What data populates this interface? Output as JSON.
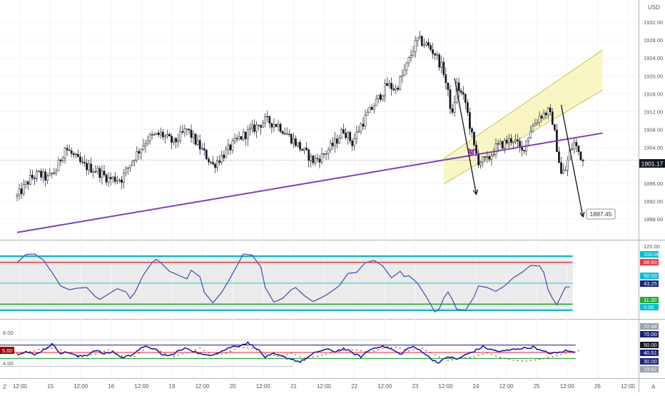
{
  "currency": "USD",
  "last_price": "1901.17",
  "target_label": "1887.45",
  "bottom_left_label": "Z",
  "bottom_right_label": "A",
  "colors": {
    "background": "#ffffff",
    "candle": "#131722",
    "trendline": "#7b3fbf",
    "channel_fill": "#f7f3b0",
    "channel_line": "#c9c25a",
    "osc_line": "#3f4fa8",
    "osc_band_fill": "#e3e3e3",
    "level_cyan": "#00bcd4",
    "level_red": "#f23645",
    "level_green": "#22ab36",
    "level_navy": "#1a1a8c",
    "rsi_dots": "#c62828",
    "rsi_badge_red": "#a00000"
  },
  "icons": [
    "alarm-clock-icon"
  ],
  "chart_data": [
    {
      "type": "candlestick",
      "name": "price",
      "ylim": [
        1884,
        1936
      ],
      "y_ticks": [
        1888,
        1892,
        1896,
        1900,
        1904,
        1908,
        1912,
        1916,
        1920,
        1924,
        1928,
        1932
      ],
      "y_tick_labels": [
        "1888.00",
        "1892.00",
        "1896.00",
        "1900.00",
        "1904.00",
        "1908.00",
        "1912.00",
        "1916.00",
        "1920.00",
        "1924.00",
        "1928.00",
        "1932.00"
      ],
      "x_tick_labels": [
        "12:00",
        "15",
        "12:00",
        "16",
        "12:00",
        "19",
        "12:00",
        "20",
        "12:00",
        "21",
        "12:00",
        "22",
        "12:00",
        "23",
        "12:00",
        "24",
        "12:00",
        "25",
        "12:00",
        "26",
        "12:00"
      ],
      "anchor_points": [
        [
          0,
          1893
        ],
        [
          6,
          1897
        ],
        [
          10,
          1898
        ],
        [
          14,
          1897
        ],
        [
          18,
          1899
        ],
        [
          22,
          1904
        ],
        [
          26,
          1902
        ],
        [
          30,
          1900
        ],
        [
          36,
          1899
        ],
        [
          42,
          1897
        ],
        [
          48,
          1897
        ],
        [
          54,
          1902
        ],
        [
          60,
          1906
        ],
        [
          66,
          1907
        ],
        [
          72,
          1905
        ],
        [
          78,
          1908
        ],
        [
          84,
          1904
        ],
        [
          90,
          1900
        ],
        [
          96,
          1903
        ],
        [
          102,
          1906
        ],
        [
          108,
          1908
        ],
        [
          114,
          1910
        ],
        [
          120,
          1909
        ],
        [
          126,
          1906
        ],
        [
          132,
          1903
        ],
        [
          136,
          1901
        ],
        [
          140,
          1902
        ],
        [
          146,
          1905
        ],
        [
          150,
          1908
        ],
        [
          154,
          1905
        ],
        [
          158,
          1909
        ],
        [
          162,
          1912
        ],
        [
          166,
          1915
        ],
        [
          170,
          1918
        ],
        [
          174,
          1917
        ],
        [
          178,
          1921
        ],
        [
          182,
          1926
        ],
        [
          184,
          1928
        ],
        [
          188,
          1927
        ],
        [
          192,
          1925
        ],
        [
          196,
          1921
        ],
        [
          198,
          1916
        ],
        [
          200,
          1911
        ],
        [
          202,
          1918
        ],
        [
          206,
          1914
        ],
        [
          210,
          1904
        ],
        [
          212,
          1901
        ],
        [
          216,
          1901
        ],
        [
          220,
          1904
        ],
        [
          224,
          1905
        ],
        [
          228,
          1906
        ],
        [
          232,
          1903
        ],
        [
          236,
          1908
        ],
        [
          240,
          1911
        ],
        [
          244,
          1912
        ],
        [
          246,
          1910
        ],
        [
          248,
          1904
        ],
        [
          250,
          1898
        ],
        [
          252,
          1899
        ],
        [
          254,
          1903
        ],
        [
          256,
          1905
        ],
        [
          258,
          1903
        ],
        [
          260,
          1901
        ]
      ],
      "annotations": {
        "trendline": [
          [
            0,
            1885
          ],
          [
            269,
            1907.2
          ]
        ],
        "channel_lower": [
          [
            196,
            1895.8
          ],
          [
            269,
            1916.8
          ]
        ],
        "channel_upper": [
          [
            196,
            1901.5
          ],
          [
            269,
            1925.8
          ]
        ],
        "arrow_left": [
          [
            201,
            1919.5
          ],
          [
            211,
            1893.5
          ]
        ],
        "arrow_right": [
          [
            250,
            1913.5
          ],
          [
            260,
            1888.5
          ]
        ]
      }
    },
    {
      "type": "line",
      "name": "oscillator",
      "ylim": [
        -12,
        125
      ],
      "levels": [
        {
          "value": 100.0,
          "label": "100.00",
          "color": "#00bcd4"
        },
        {
          "value": 88.6,
          "label": "88.60",
          "color": "#f23645"
        },
        {
          "value": 50.0,
          "label": "50.00",
          "color": "#00bcd4"
        },
        {
          "value": 11.3,
          "label": "11.30",
          "color": "#22ab36"
        },
        {
          "value": 0.0,
          "label": "0.00",
          "color": "#00bcd4"
        }
      ],
      "current_value": "43.25",
      "y_ticks": [
        120
      ],
      "y_tick_labels": [
        "120.00"
      ],
      "anchor_points": [
        [
          0,
          88
        ],
        [
          4,
          103
        ],
        [
          8,
          104
        ],
        [
          12,
          93
        ],
        [
          16,
          70
        ],
        [
          20,
          45
        ],
        [
          24,
          38
        ],
        [
          28,
          41
        ],
        [
          32,
          42
        ],
        [
          36,
          25
        ],
        [
          38,
          20
        ],
        [
          42,
          30
        ],
        [
          46,
          40
        ],
        [
          50,
          34
        ],
        [
          52,
          22
        ],
        [
          54,
          32
        ],
        [
          58,
          65
        ],
        [
          62,
          88
        ],
        [
          64,
          94
        ],
        [
          66,
          88
        ],
        [
          70,
          72
        ],
        [
          74,
          65
        ],
        [
          78,
          58
        ],
        [
          80,
          74
        ],
        [
          84,
          62
        ],
        [
          86,
          33
        ],
        [
          90,
          14
        ],
        [
          94,
          33
        ],
        [
          98,
          60
        ],
        [
          104,
          104
        ],
        [
          108,
          102
        ],
        [
          112,
          80
        ],
        [
          114,
          42
        ],
        [
          118,
          15
        ],
        [
          122,
          22
        ],
        [
          126,
          38
        ],
        [
          128,
          42
        ],
        [
          132,
          27
        ],
        [
          136,
          16
        ],
        [
          142,
          28
        ],
        [
          148,
          45
        ],
        [
          152,
          68
        ],
        [
          156,
          70
        ],
        [
          160,
          88
        ],
        [
          164,
          92
        ],
        [
          168,
          82
        ],
        [
          172,
          60
        ],
        [
          176,
          72
        ],
        [
          178,
          62
        ],
        [
          180,
          64
        ],
        [
          184,
          50
        ],
        [
          188,
          25
        ],
        [
          192,
          -3
        ],
        [
          194,
          3
        ],
        [
          196,
          22
        ],
        [
          198,
          34
        ],
        [
          200,
          20
        ],
        [
          202,
          2
        ],
        [
          206,
          0
        ],
        [
          210,
          25
        ],
        [
          212,
          45
        ],
        [
          216,
          42
        ],
        [
          220,
          35
        ],
        [
          224,
          45
        ],
        [
          228,
          60
        ],
        [
          232,
          70
        ],
        [
          236,
          83
        ],
        [
          240,
          82
        ],
        [
          242,
          70
        ],
        [
          244,
          38
        ],
        [
          246,
          22
        ],
        [
          248,
          10
        ],
        [
          252,
          43
        ],
        [
          254,
          43
        ]
      ]
    },
    {
      "type": "line",
      "name": "rsi-oscillator",
      "ylim": [
        0,
        12.5
      ],
      "levels": [
        {
          "value": 7.3,
          "label": "70.00",
          "color": "#1a1a8c"
        },
        {
          "value": 5.6,
          "label": "50.00",
          "color": "#f23645"
        },
        {
          "value": 4.2,
          "label": "30.00",
          "color": "#22ab36"
        }
      ],
      "current_value": "40.51",
      "y_ticks": [
        8.0,
        4.0
      ],
      "y_tick_labels": [
        "8.00",
        "4.00"
      ],
      "right_labels": [
        "72.44",
        "70.00",
        "50.00",
        "40.51",
        "30.00",
        "19.52"
      ],
      "left_badge": "5.60",
      "anchor_points": [
        [
          0,
          5.3
        ],
        [
          4,
          5.8
        ],
        [
          8,
          5.0
        ],
        [
          12,
          6.2
        ],
        [
          16,
          7.5
        ],
        [
          20,
          5.5
        ],
        [
          24,
          5.6
        ],
        [
          28,
          4.6
        ],
        [
          32,
          5.0
        ],
        [
          36,
          6.2
        ],
        [
          40,
          5.2
        ],
        [
          44,
          5.8
        ],
        [
          48,
          4.4
        ],
        [
          52,
          4.9
        ],
        [
          56,
          6.3
        ],
        [
          60,
          7.0
        ],
        [
          64,
          6.1
        ],
        [
          66,
          5.2
        ],
        [
          70,
          4.8
        ],
        [
          74,
          5.9
        ],
        [
          78,
          6.6
        ],
        [
          82,
          5.7
        ],
        [
          86,
          4.9
        ],
        [
          90,
          5.2
        ],
        [
          94,
          5.9
        ],
        [
          98,
          6.8
        ],
        [
          102,
          7.2
        ],
        [
          106,
          7.8
        ],
        [
          110,
          6.6
        ],
        [
          114,
          4.5
        ],
        [
          118,
          5.2
        ],
        [
          122,
          4.6
        ],
        [
          126,
          4.1
        ],
        [
          130,
          3.4
        ],
        [
          134,
          4.6
        ],
        [
          138,
          5.8
        ],
        [
          142,
          6.3
        ],
        [
          146,
          5.8
        ],
        [
          150,
          6.5
        ],
        [
          154,
          5.5
        ],
        [
          158,
          4.6
        ],
        [
          162,
          6.2
        ],
        [
          166,
          7.0
        ],
        [
          170,
          6.8
        ],
        [
          174,
          5.8
        ],
        [
          176,
          5.1
        ],
        [
          180,
          6.7
        ],
        [
          182,
          6.8
        ],
        [
          186,
          5.9
        ],
        [
          190,
          4.2
        ],
        [
          194,
          3.2
        ],
        [
          198,
          4.7
        ],
        [
          202,
          4.0
        ],
        [
          206,
          5.0
        ],
        [
          210,
          5.9
        ],
        [
          214,
          6.9
        ],
        [
          218,
          6.2
        ],
        [
          222,
          5.8
        ],
        [
          226,
          6.1
        ],
        [
          230,
          6.5
        ],
        [
          234,
          6.6
        ],
        [
          238,
          6.9
        ],
        [
          240,
          6.1
        ],
        [
          244,
          5.5
        ],
        [
          248,
          5.4
        ],
        [
          252,
          6.0
        ],
        [
          256,
          5.6
        ]
      ],
      "dots_anchor_points": [
        [
          0,
          5.4
        ],
        [
          6,
          5.8
        ],
        [
          12,
          6.5
        ],
        [
          18,
          6.6
        ],
        [
          24,
          5.4
        ],
        [
          30,
          4.6
        ],
        [
          36,
          5.2
        ],
        [
          42,
          6.2
        ],
        [
          48,
          4.8
        ],
        [
          54,
          4.7
        ],
        [
          60,
          6.8
        ],
        [
          66,
          5.8
        ],
        [
          72,
          4.6
        ],
        [
          78,
          5.6
        ],
        [
          84,
          6.6
        ],
        [
          90,
          5.0
        ],
        [
          96,
          5.4
        ],
        [
          102,
          6.8
        ],
        [
          108,
          6.6
        ],
        [
          114,
          5.3
        ],
        [
          120,
          4.7
        ],
        [
          126,
          5.4
        ],
        [
          132,
          4.3
        ],
        [
          138,
          4.7
        ],
        [
          144,
          5.5
        ],
        [
          150,
          6.1
        ],
        [
          156,
          6.2
        ],
        [
          162,
          5.6
        ],
        [
          168,
          6.5
        ],
        [
          174,
          6.8
        ],
        [
          180,
          6.0
        ],
        [
          186,
          6.6
        ],
        [
          192,
          5.0
        ],
        [
          198,
          3.7
        ],
        [
          204,
          4.3
        ],
        [
          210,
          4.6
        ],
        [
          216,
          5.5
        ],
        [
          222,
          4.4
        ],
        [
          228,
          3.8
        ],
        [
          234,
          3.6
        ],
        [
          240,
          4.0
        ],
        [
          246,
          4.6
        ],
        [
          252,
          5.4
        ],
        [
          258,
          6.0
        ]
      ]
    }
  ]
}
